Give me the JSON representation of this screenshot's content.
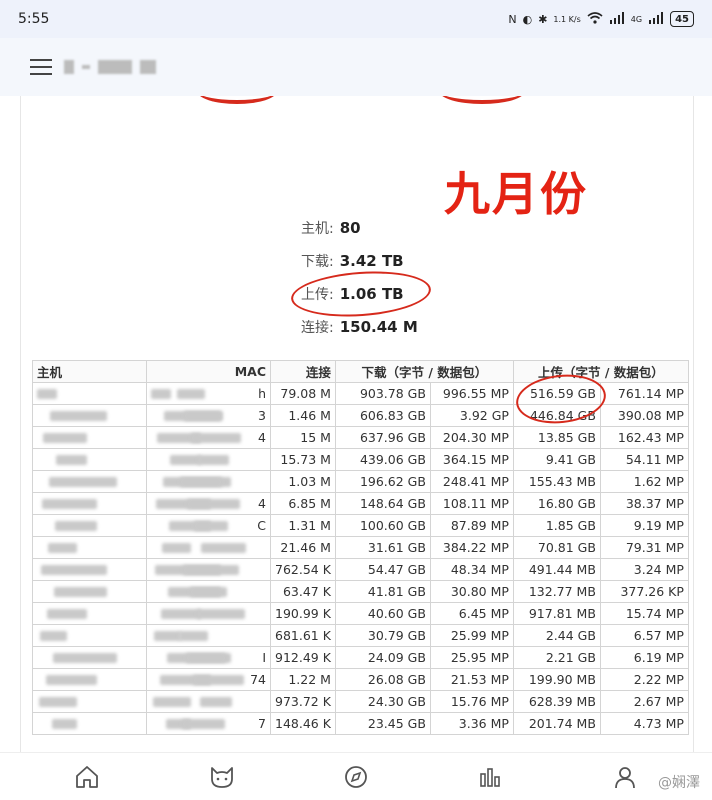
{
  "status_bar": {
    "time": "5:55",
    "network_speed": "1.1 K/s",
    "network_label": "4G",
    "battery": "45"
  },
  "screenshot": {
    "month_label": "九月份",
    "summary": [
      {
        "key": "主机:",
        "value": "80"
      },
      {
        "key": "下载:",
        "value": "3.42 TB"
      },
      {
        "key": "上传:",
        "value": "1.06 TB"
      },
      {
        "key": "连接:",
        "value": "150.44 M"
      }
    ],
    "table": {
      "headers": [
        "主机",
        "MAC",
        "连接",
        "下载（字节 / 数据包）",
        "上传（字节 / 数据包）"
      ],
      "rows": [
        {
          "mac_tail": "h",
          "conn": "79.08 M",
          "dl_bytes": "903.78 GB",
          "dl_pkts": "996.55 MP",
          "ul_bytes": "516.59 GB",
          "ul_pkts": "761.14 MP"
        },
        {
          "mac_tail": "3",
          "conn": "1.46 M",
          "dl_bytes": "606.83 GB",
          "dl_pkts": "3.92 GP",
          "ul_bytes": "446.84 GB",
          "ul_pkts": "390.08 MP"
        },
        {
          "mac_tail": "4",
          "conn": "15 M",
          "dl_bytes": "637.96 GB",
          "dl_pkts": "204.30 MP",
          "ul_bytes": "13.85 GB",
          "ul_pkts": "162.43 MP"
        },
        {
          "mac_tail": "",
          "conn": "15.73 M",
          "dl_bytes": "439.06 GB",
          "dl_pkts": "364.15 MP",
          "ul_bytes": "9.41 GB",
          "ul_pkts": "54.11 MP"
        },
        {
          "mac_tail": "",
          "conn": "1.03 M",
          "dl_bytes": "196.62 GB",
          "dl_pkts": "248.41 MP",
          "ul_bytes": "155.43 MB",
          "ul_pkts": "1.62 MP"
        },
        {
          "mac_tail": "4",
          "conn": "6.85 M",
          "dl_bytes": "148.64 GB",
          "dl_pkts": "108.11 MP",
          "ul_bytes": "16.80 GB",
          "ul_pkts": "38.37 MP"
        },
        {
          "mac_tail": "C",
          "conn": "1.31 M",
          "dl_bytes": "100.60 GB",
          "dl_pkts": "87.89 MP",
          "ul_bytes": "1.85 GB",
          "ul_pkts": "9.19 MP"
        },
        {
          "mac_tail": "",
          "conn": "21.46 M",
          "dl_bytes": "31.61 GB",
          "dl_pkts": "384.22 MP",
          "ul_bytes": "70.81 GB",
          "ul_pkts": "79.31 MP"
        },
        {
          "mac_tail": "",
          "conn": "762.54 K",
          "dl_bytes": "54.47 GB",
          "dl_pkts": "48.34 MP",
          "ul_bytes": "491.44 MB",
          "ul_pkts": "3.24 MP"
        },
        {
          "mac_tail": "",
          "conn": "63.47 K",
          "dl_bytes": "41.81 GB",
          "dl_pkts": "30.80 MP",
          "ul_bytes": "132.77 MB",
          "ul_pkts": "377.26 KP"
        },
        {
          "mac_tail": "",
          "conn": "190.99 K",
          "dl_bytes": "40.60 GB",
          "dl_pkts": "6.45 MP",
          "ul_bytes": "917.81 MB",
          "ul_pkts": "15.74 MP"
        },
        {
          "mac_tail": "",
          "conn": "681.61 K",
          "dl_bytes": "30.79 GB",
          "dl_pkts": "25.99 MP",
          "ul_bytes": "2.44 GB",
          "ul_pkts": "6.57 MP"
        },
        {
          "mac_tail": "I",
          "conn": "912.49 K",
          "dl_bytes": "24.09 GB",
          "dl_pkts": "25.95 MP",
          "ul_bytes": "2.21 GB",
          "ul_pkts": "6.19 MP"
        },
        {
          "mac_tail": "74",
          "conn": "1.22 M",
          "dl_bytes": "26.08 GB",
          "dl_pkts": "21.53 MP",
          "ul_bytes": "199.90 MB",
          "ul_pkts": "2.22 MP"
        },
        {
          "mac_tail": "",
          "conn": "973.72 K",
          "dl_bytes": "24.30 GB",
          "dl_pkts": "15.76 MP",
          "ul_bytes": "628.39 MB",
          "ul_pkts": "2.67 MP"
        },
        {
          "mac_tail": "7",
          "conn": "148.46 K",
          "dl_bytes": "23.45 GB",
          "dl_pkts": "3.36 MP",
          "ul_bytes": "201.74 MB",
          "ul_pkts": "4.73 MP"
        }
      ]
    }
  },
  "nav": {
    "items": [
      "home-icon",
      "pet-icon",
      "compass-icon",
      "chart-icon",
      "profile-icon"
    ]
  },
  "watermark": "@娴澤",
  "colors": {
    "annotation_red": "#d62a1c",
    "month_red": "#e42314"
  }
}
